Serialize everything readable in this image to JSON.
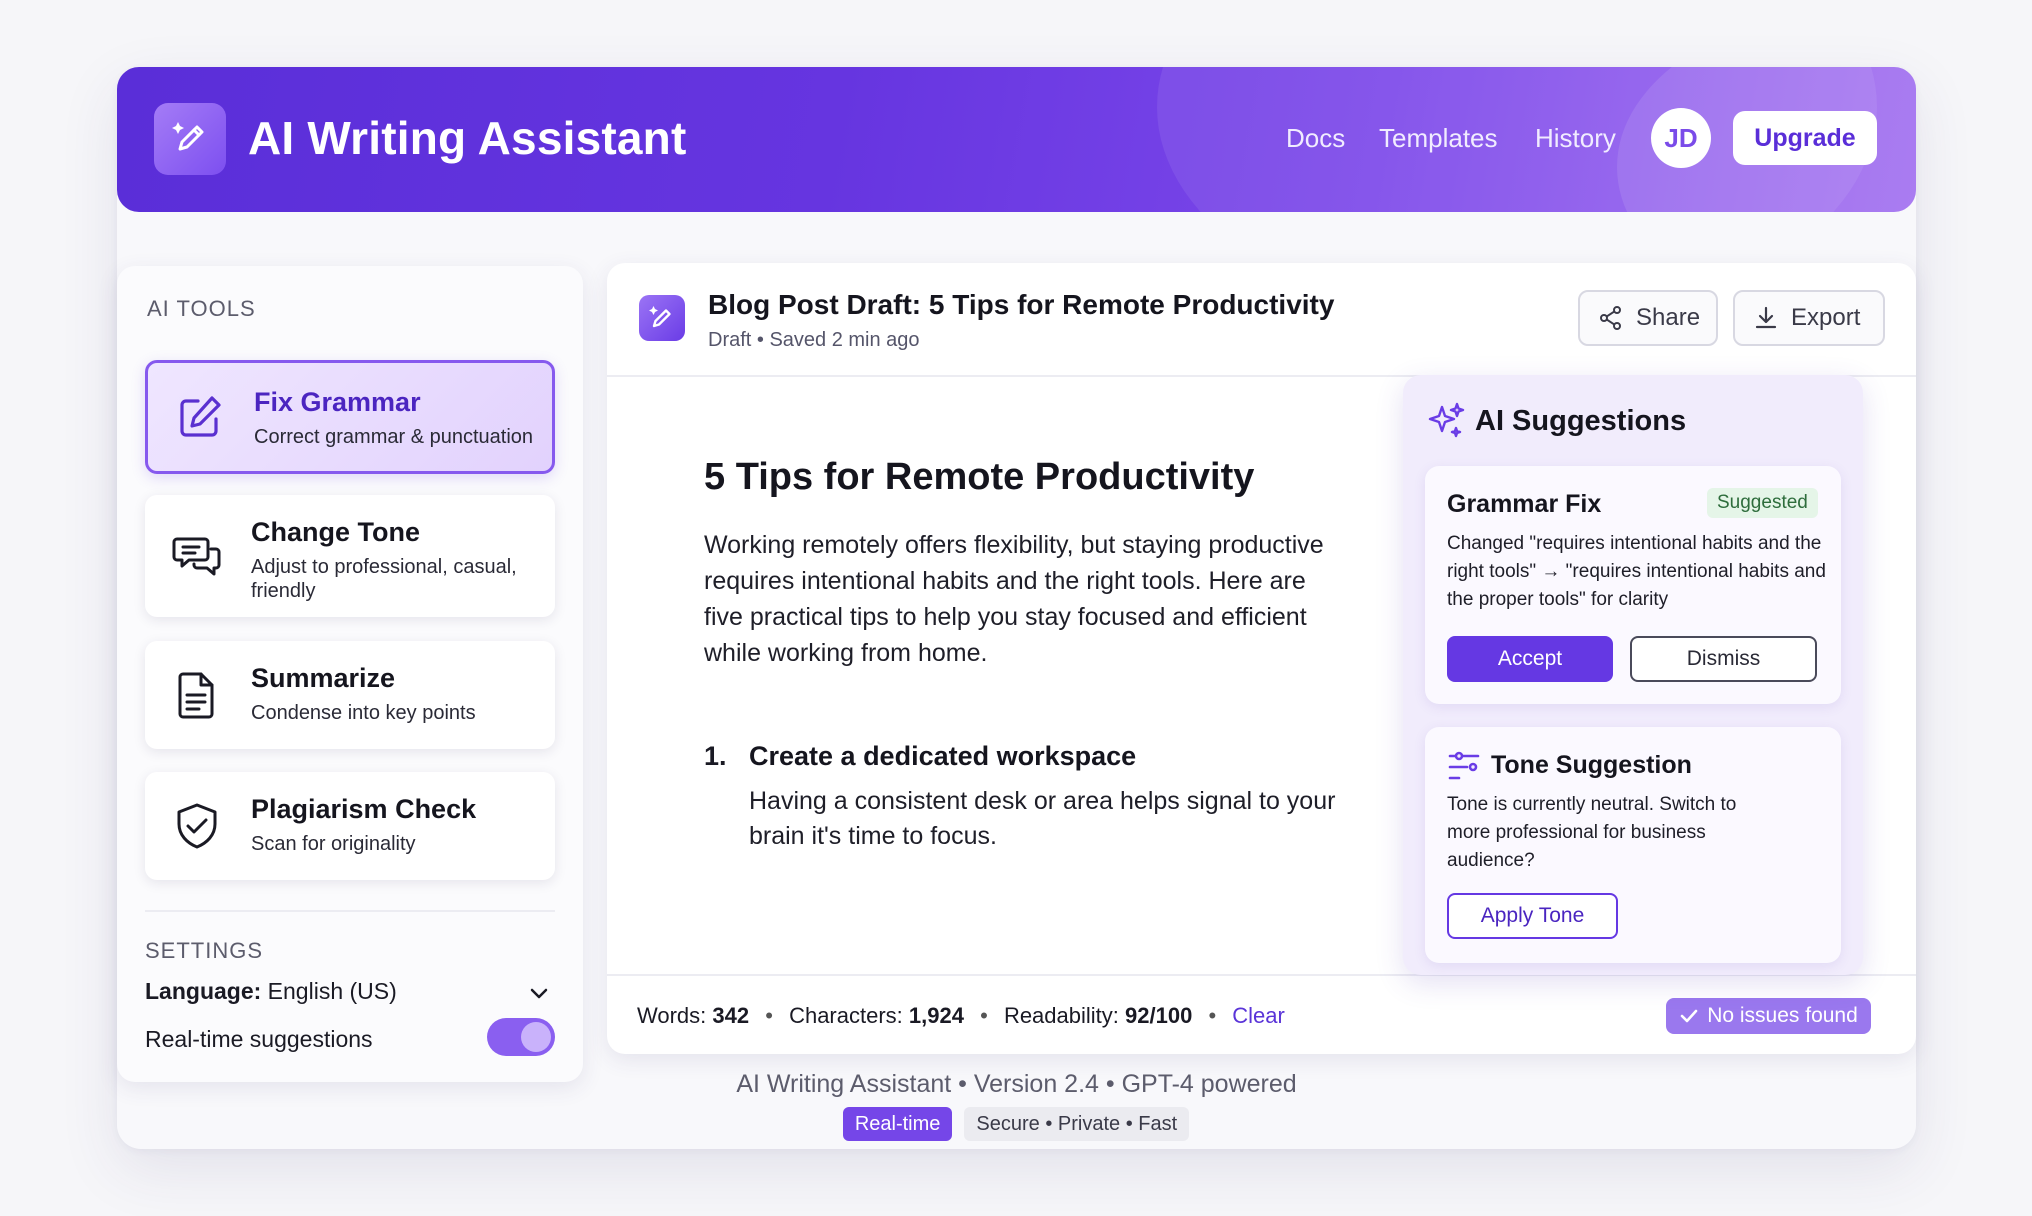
{
  "header": {
    "title": "AI Writing Assistant",
    "nav": [
      "Docs",
      "Templates",
      "History"
    ],
    "avatar_initials": "JD",
    "upgrade_label": "Upgrade"
  },
  "sidebar": {
    "tools_label": "AI TOOLS",
    "tools": [
      {
        "name": "Fix Grammar",
        "desc": "Correct grammar & punctuation",
        "icon": "edit-icon",
        "active": true
      },
      {
        "name": "Change Tone",
        "desc": "Adjust to professional, casual, friendly",
        "icon": "chat-bubbles-icon",
        "active": false
      },
      {
        "name": "Summarize",
        "desc": "Condense into key points",
        "icon": "document-icon",
        "active": false
      },
      {
        "name": "Plagiarism Check",
        "desc": "Scan for originality",
        "icon": "shield-check-icon",
        "active": false
      }
    ],
    "settings_label": "SETTINGS",
    "language_label": "Language:",
    "language_value": "English (US)",
    "realtime_label": "Real-time suggestions",
    "realtime_on": true
  },
  "document": {
    "title": "Blog Post Draft: 5 Tips for Remote Productivity",
    "meta": "Draft • Saved 2 min ago",
    "share_label": "Share",
    "export_label": "Export",
    "heading": "5 Tips for Remote Productivity",
    "intro": "Working remotely offers flexibility, but staying productive requires intentional habits and the right tools. Here are five practical tips to help you stay focused and efficient while working from home.",
    "list": [
      {
        "num": "1.",
        "title": "Create a dedicated workspace",
        "text": "Having a consistent desk or area helps signal to your brain it's time to focus."
      }
    ]
  },
  "stats": {
    "words_label": "Words:",
    "words": "342",
    "chars_label": "Characters:",
    "chars": "1,924",
    "readability_label": "Readability:",
    "readability": "92/100",
    "clear_label": "Clear",
    "status": "No issues found"
  },
  "suggestions": {
    "title": "AI Suggestions",
    "grammar": {
      "title": "Grammar Fix",
      "badge": "Suggested",
      "text": "Changed \"requires intentional habits and the right tools\" → \"requires intentional habits and the proper tools\" for clarity",
      "accept": "Accept",
      "dismiss": "Dismiss"
    },
    "tone": {
      "title": "Tone Suggestion",
      "text": "Tone is currently neutral. Switch to more professional for business audience?",
      "apply": "Apply Tone"
    }
  },
  "footer": {
    "line": "AI Writing Assistant • Version 2.4 • GPT-4 powered",
    "tag1": "Real-time",
    "tag2": "Secure • Private • Fast"
  },
  "colors": {
    "accent": "#6538e3",
    "header_start": "#5a2ed8",
    "header_end": "#a16ef0"
  }
}
